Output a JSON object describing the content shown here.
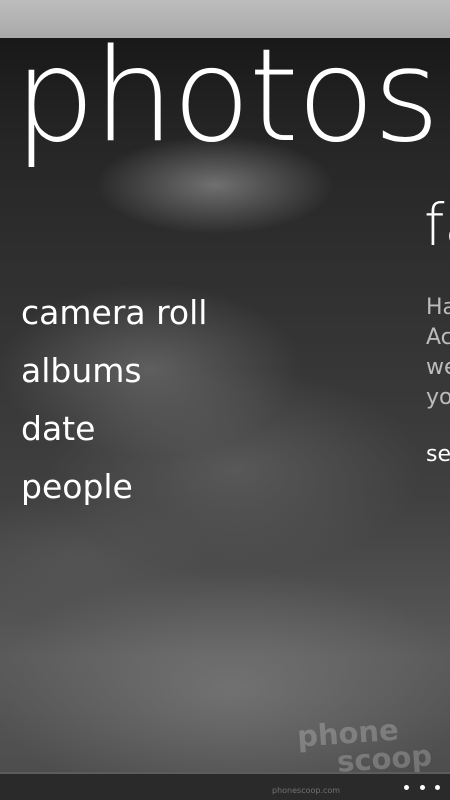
{
  "app": {
    "title": "photos"
  },
  "menu": {
    "items": [
      {
        "label": "camera roll"
      },
      {
        "label": "albums"
      },
      {
        "label": "date"
      },
      {
        "label": "people"
      }
    ]
  },
  "next_pane": {
    "title_fragment": "fa",
    "body_fragments": [
      "Ha",
      "Ac",
      "we",
      "yo"
    ],
    "link_fragment": "se"
  },
  "watermark": {
    "line1": "phone",
    "line2": "scoop"
  },
  "app_bar": {
    "more_icon": "ellipsis-icon",
    "source_text": "phonescoop.com"
  },
  "colors": {
    "text_primary": "#ffffff",
    "text_secondary": "#bcbcbc",
    "status_bar": "#b3b3b3",
    "app_bar": "#2a2a2a"
  }
}
